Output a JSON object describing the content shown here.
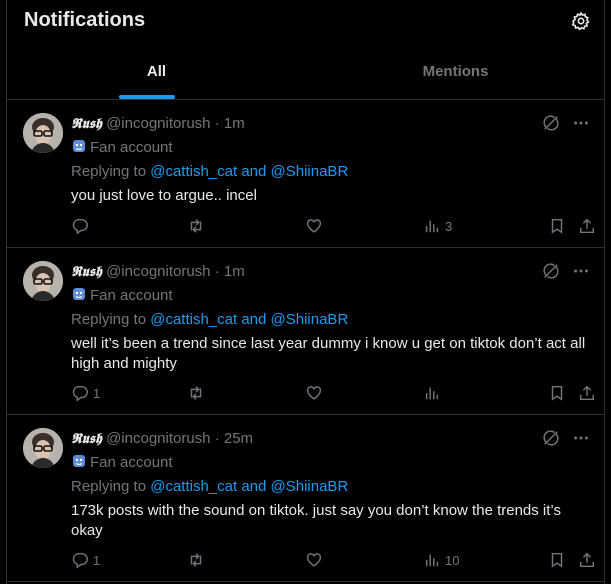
{
  "header": {
    "title": "Notifications",
    "tabs": [
      {
        "label": "All",
        "active": true
      },
      {
        "label": "Mentions",
        "active": false
      }
    ],
    "settings_icon": "gear-icon"
  },
  "colors": {
    "accent": "#1d9bf0",
    "muted": "#71767b",
    "text": "#e7e9ea",
    "divider": "#2f3336",
    "background": "#000000"
  },
  "tweets": [
    {
      "display_name": "𝕽𝖚𝖘𝖍",
      "handle": "@incognitorush",
      "separator": "·",
      "time": "1m",
      "badge": "Fan account",
      "reply_prefix": "Replying to ",
      "reply_mentions": "@cattish_cat and @ShiinaBR",
      "text": "you just love to argue.. incel",
      "replies": "",
      "reposts": "",
      "likes": "",
      "views": "3"
    },
    {
      "display_name": "𝕽𝖚𝖘𝖍",
      "handle": "@incognitorush",
      "separator": "·",
      "time": "1m",
      "badge": "Fan account",
      "reply_prefix": "Replying to ",
      "reply_mentions": "@cattish_cat and @ShiinaBR",
      "text": "well it’s been a trend since last year dummy i know u get on tiktok don’t act all high and mighty",
      "replies": "1",
      "reposts": "",
      "likes": "",
      "views": ""
    },
    {
      "display_name": "𝕽𝖚𝖘𝖍",
      "handle": "@incognitorush",
      "separator": "·",
      "time": "25m",
      "badge": "Fan account",
      "reply_prefix": "Replying to ",
      "reply_mentions": "@cattish_cat and @ShiinaBR",
      "text": "173k posts with the sound on tiktok. just say you don’t know the trends it’s okay",
      "replies": "1",
      "reposts": "",
      "likes": "",
      "views": "10"
    }
  ]
}
